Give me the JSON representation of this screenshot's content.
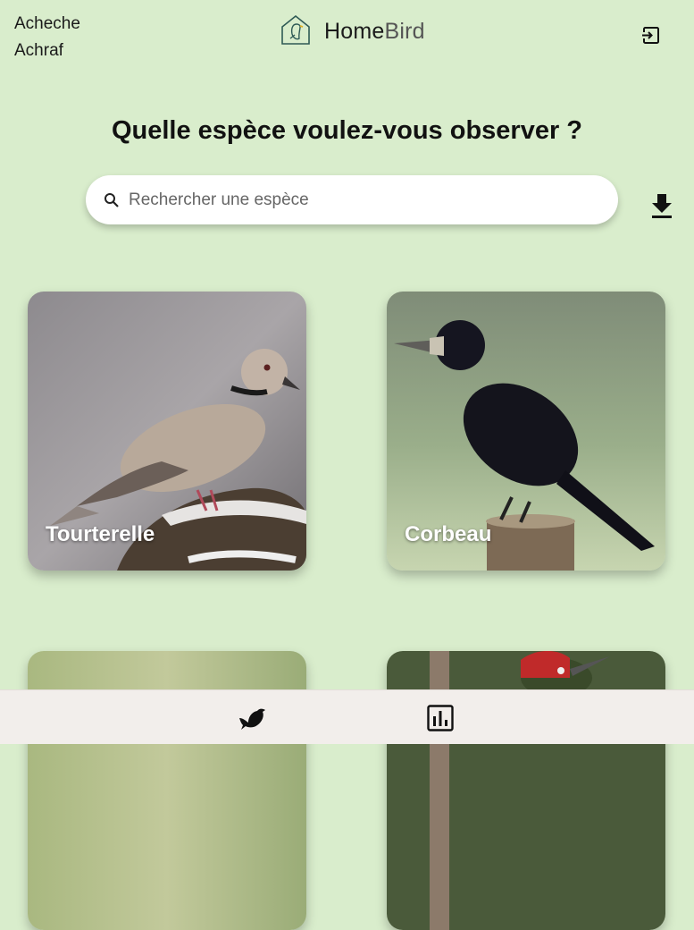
{
  "user": {
    "first_line": "Acheche",
    "second_line": "Achraf"
  },
  "brand": {
    "name_main": "Home",
    "name_accent": "Bird",
    "logo_icon": "house-bird-logo-icon"
  },
  "header": {
    "logout_icon": "logout-icon"
  },
  "page": {
    "title": "Quelle espèce voulez-vous observer ?"
  },
  "search": {
    "placeholder": "Rechercher une espèce",
    "value": "",
    "icon": "search-icon"
  },
  "actions": {
    "download_icon": "download-icon"
  },
  "species": [
    {
      "name": "Tourterelle"
    },
    {
      "name": "Corbeau"
    },
    {
      "name": ""
    },
    {
      "name": ""
    }
  ],
  "bottom_nav": {
    "items": [
      {
        "icon": "bird-icon"
      },
      {
        "icon": "chart-icon"
      }
    ]
  },
  "colors": {
    "background": "#d9edcc",
    "nav_background": "#f2eeeb",
    "card_label": "#ffffff"
  }
}
